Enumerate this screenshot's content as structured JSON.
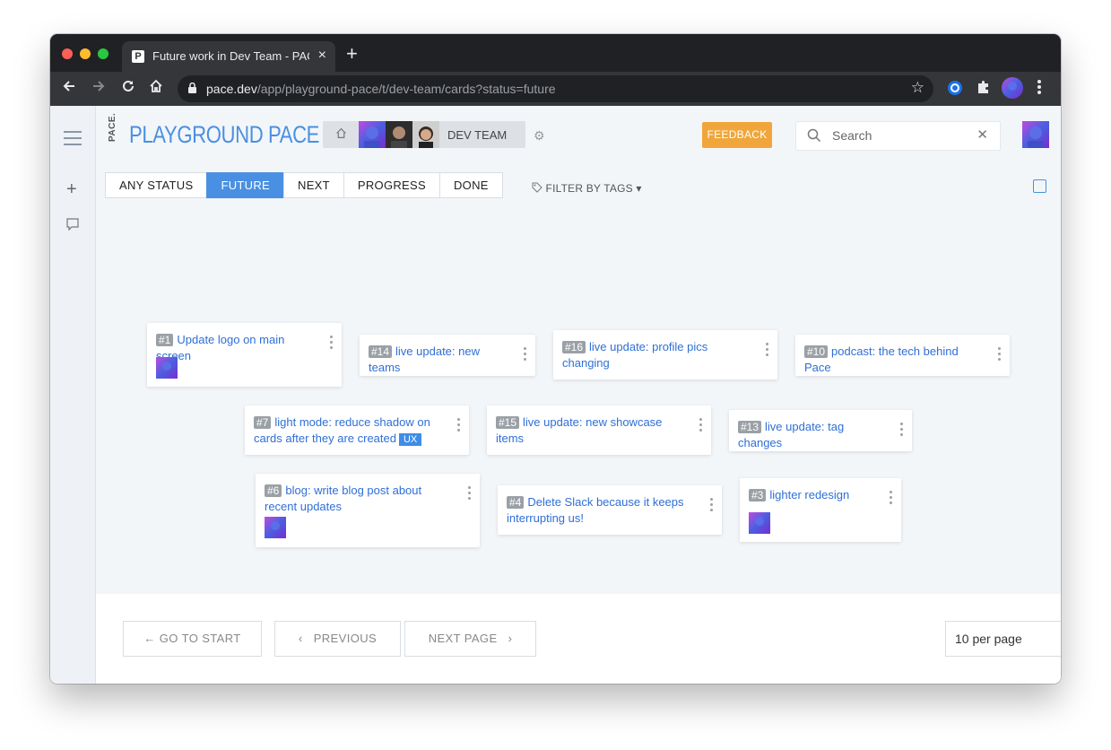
{
  "browser": {
    "tab_title": "Future work in Dev Team - PACE",
    "tab_favicon": "P",
    "url_host": "pace.dev",
    "url_path": "/app/playground-pace/t/dev-team/cards?status=future",
    "icons": [
      "back-icon",
      "forward-icon",
      "reload-icon",
      "home-icon",
      "lock-icon",
      "star-icon",
      "extension-icon",
      "puzzle-icon",
      "profile-icon",
      "menu-icon"
    ]
  },
  "sidebar": {
    "icons": [
      "hamburger-icon",
      "plus-icon",
      "comment-icon"
    ]
  },
  "header": {
    "brand_small": "PACE.",
    "brand": "PLAYGROUND PACE",
    "team_name": "DEV TEAM",
    "feedback_label": "FEEDBACK",
    "search_placeholder": "Search"
  },
  "status_filter": {
    "options": [
      "ANY STATUS",
      "FUTURE",
      "NEXT",
      "PROGRESS",
      "DONE"
    ],
    "selected": "FUTURE"
  },
  "filter_by_tags": "FILTER BY TAGS",
  "cards": [
    {
      "num": "#1",
      "title": "Update logo on main screen",
      "has_avatar": true
    },
    {
      "num": "#14",
      "title": "live update: new teams",
      "has_avatar": false
    },
    {
      "num": "#16",
      "title": "live update: profile pics changing",
      "has_avatar": false
    },
    {
      "num": "#10",
      "title": "podcast: the tech behind Pace",
      "has_avatar": false
    },
    {
      "num": "#7",
      "title": "light mode: reduce shadow on cards after they are created",
      "tag": "UX",
      "has_avatar": false
    },
    {
      "num": "#15",
      "title": "live update: new showcase items",
      "has_avatar": false
    },
    {
      "num": "#13",
      "title": "live update: tag changes",
      "has_avatar": false
    },
    {
      "num": "#6",
      "title": "blog: write blog post about recent updates",
      "has_avatar": true
    },
    {
      "num": "#4",
      "title": "Delete Slack because it keeps interrupting us!",
      "has_avatar": false
    },
    {
      "num": "#3",
      "title": "lighter redesign",
      "has_avatar": true
    }
  ],
  "pagination": {
    "go_to_start": "GO TO START",
    "previous": "PREVIOUS",
    "next_page": "NEXT PAGE",
    "per_page": "10 per page"
  },
  "colors": {
    "accent": "#4a90e2",
    "feedback": "#f0a63a",
    "background": "#f3f6f9"
  }
}
